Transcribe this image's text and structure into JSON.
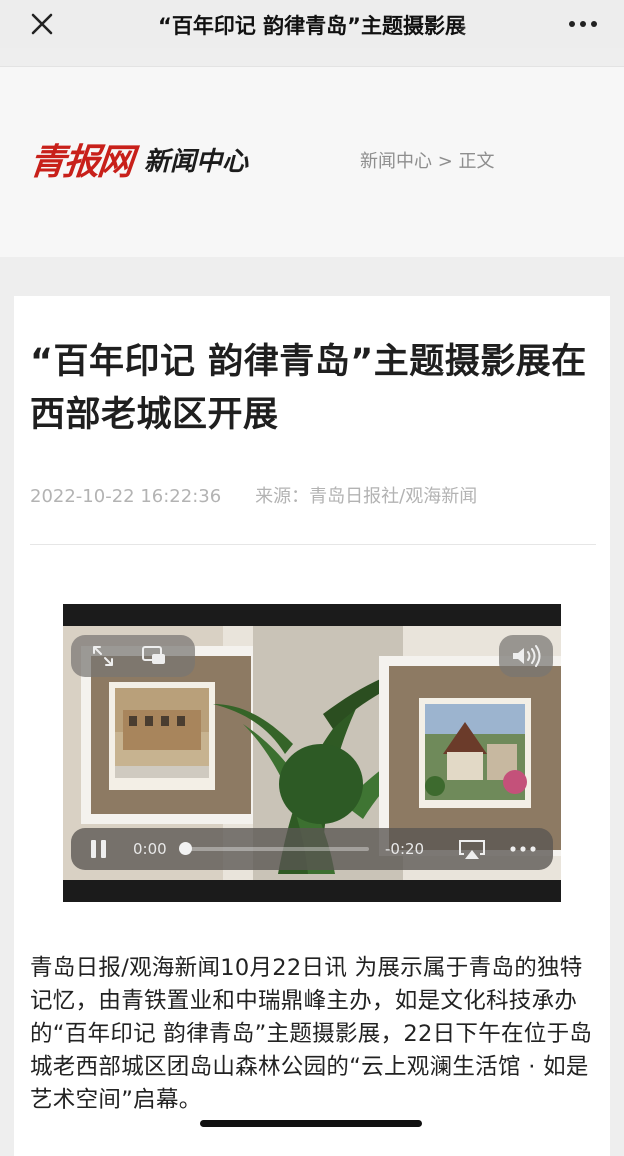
{
  "nav": {
    "title": "“百年印记 韵律青岛”主题摄影展",
    "close_icon": "close-icon",
    "more_icon": "more-icon"
  },
  "header": {
    "logo_brand": "青报网",
    "logo_sub": "新闻中心",
    "breadcrumb": "新闻中心 > 正文"
  },
  "article": {
    "title": "“百年印记 韵律青岛”主题摄影展在西部老城区开展",
    "date": "2022-10-22 16:22:36",
    "source": "来源：青岛日报社/观海新闻",
    "body": "青岛日报/观海新闻10月22日讯  为展示属于青岛的独特记忆，由青铁置业和中瑞鼎峰主办，如是文化科技承办的“百年印记 韵律青岛”主题摄影展，22日下午在位于岛城老西部城区团岛山森林公园的“云上观澜生活馆 · 如是艺术空间”启幕。"
  },
  "video": {
    "current_time": "0:00",
    "remaining_time": "-0:20",
    "progress": 0,
    "icons": [
      "fullscreen-icon",
      "picture-in-picture-icon",
      "volume-icon",
      "pause-icon",
      "airplay-icon",
      "more-options-icon"
    ]
  },
  "colors": {
    "brand_red": "#c8201a",
    "background": "#eeeeee",
    "card": "#ffffff"
  }
}
